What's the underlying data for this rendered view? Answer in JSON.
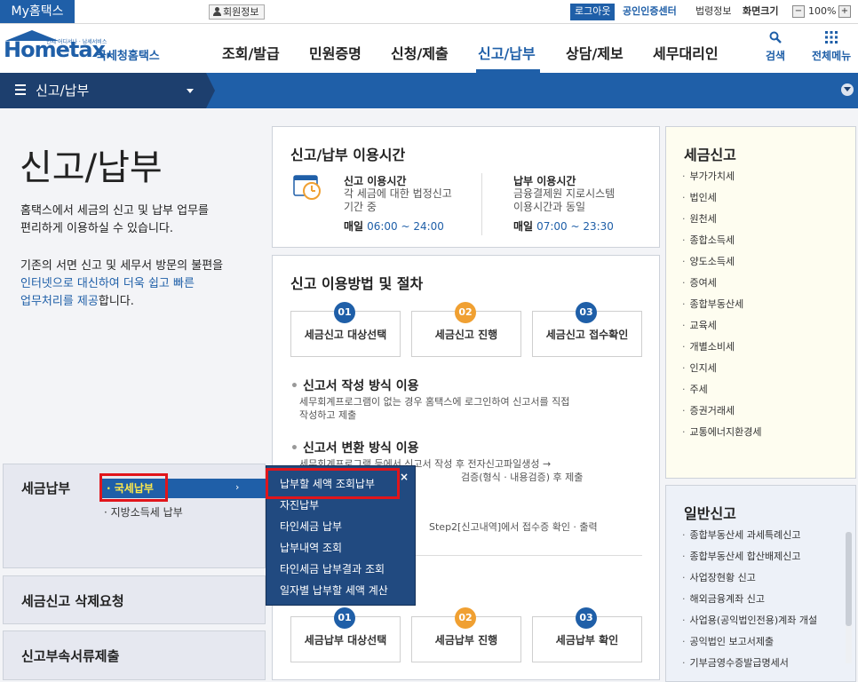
{
  "topbar": {
    "my_hometax": "My홈택스",
    "member_info": "회원정보",
    "logout": "로그아웃",
    "cert_center": "공인인증센터",
    "law_info": "법령정보",
    "screen_size": "화면크기",
    "zoom_minus": "−",
    "zoom_value": "100%",
    "zoom_plus": "+"
  },
  "header": {
    "logo_word": "Hometax.",
    "logo_small": "언제 어디서나 · 납세서비스",
    "logo_kr": "국세청홈택스",
    "nav": [
      "조회/발급",
      "민원증명",
      "신청/제출",
      "신고/납부",
      "상담/제보",
      "세무대리인"
    ],
    "active_nav": "신고/납부",
    "search": "검색",
    "all_menu": "전체메뉴"
  },
  "location": {
    "title": "신고/납부"
  },
  "intro": {
    "title": "신고/납부",
    "p1_line1": "홈택스에서 세금의 신고 및 납부 업무를",
    "p1_line2": "편리하게 이용하실 수 있습니다.",
    "p2_line1": "기존의 서면 신고 및 세무서 방문의 불편을",
    "p2_hl1": "인터넷으로 대신하여 더욱 쉽고 빠른",
    "p2_hl2": "업무처리를 제공",
    "p2_tail": "합니다."
  },
  "usage": {
    "title": "신고/납부 이용시간",
    "report_title": "신고 이용시간",
    "report_text1": "각 세금에 대한 법정신고",
    "report_text2": "기간 중",
    "report_day": "매일",
    "report_time": "06:00 ~ 24:00",
    "pay_title": "납부 이용시간",
    "pay_text1": "금융결제원 지로시스템",
    "pay_text2": "이용시간과 동일",
    "pay_day": "매일",
    "pay_time": "07:00 ~ 23:30"
  },
  "procedure": {
    "title": "신고 이용방법 및 절차",
    "steps": [
      {
        "num": "01",
        "label": "세금신고 대상선택"
      },
      {
        "num": "02",
        "label": "세금신고 진행"
      },
      {
        "num": "03",
        "label": "세금신고 접수확인"
      }
    ],
    "method1_title": "신고서 작성 방식 이용",
    "method1_text1": "세무회계프로그램이 없는 경우 홈택스에 로그인하여 신고서를 직접",
    "method1_text2": "작성하고 제출",
    "method2_title": "신고서 변환 방식 이용",
    "method2_text1": "세무회계프로그램 등에서 신고서 작성 후 전자신고파일생성 →",
    "method2_text2": "검증(형식 · 내용검증) 후 제출",
    "method3_text": "Step2[신고내역]에서 접수증 확인 · 출력",
    "pay_steps": [
      {
        "num": "01",
        "label": "세금납부 대상선택"
      },
      {
        "num": "02",
        "label": "세금납부 진행"
      },
      {
        "num": "03",
        "label": "세금납부 확인"
      }
    ]
  },
  "tax_report": {
    "title": "세금신고",
    "items": [
      "부가가치세",
      "법인세",
      "원천세",
      "종합소득세",
      "양도소득세",
      "증여세",
      "종합부동산세",
      "교육세",
      "개별소비세",
      "인지세",
      "주세",
      "증권거래세",
      "교통에너지환경세"
    ]
  },
  "general_report": {
    "title": "일반신고",
    "items": [
      "종합부동산세 과세특례신고",
      "종합부동산세 합산배제신고",
      "사업장현황 신고",
      "해외금융계좌 신고",
      "사업용(공익법인전용)계좌 개설",
      "공익법인 보고서제출",
      "기부금영수증발급명세서"
    ]
  },
  "left_menu": {
    "tax_payment": "세금납부",
    "national_tax": "국세납부",
    "local_tax": "지방소득세 납부",
    "delete_request": "세금신고 삭제요청",
    "attach_docs": "신고부속서류제출"
  },
  "flyout": {
    "items": [
      "납부할 세액 조회납부",
      "자진납부",
      "타인세금 납부",
      "납부내역 조회",
      "타인세금 납부결과 조회",
      "일자별 납부할 세액 계산"
    ],
    "close": "×"
  },
  "colors": {
    "brand": "#1f5fa8",
    "highlight": "#e1151b",
    "orange": "#f0a032"
  }
}
